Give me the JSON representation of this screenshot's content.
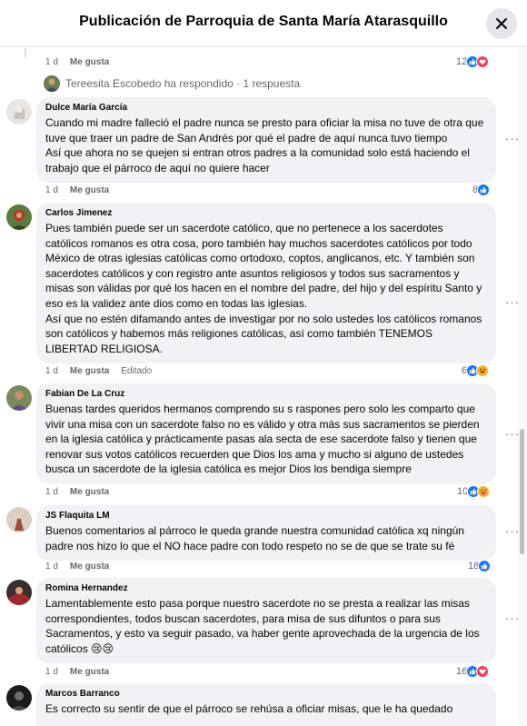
{
  "header": {
    "title": "Publicación de Parroquia de Santa María Atarasquillo"
  },
  "top_reply": {
    "time": "1 d",
    "like_label": "Me gusta",
    "reaction_count": "12",
    "replied_text": "Tereesita Escobedo ha respondido · 1 respuesta"
  },
  "comments": [
    {
      "author": "Dulce María García",
      "text": "Cuando mi madre falleció el padre nunca se presto para oficiar la misa no tuve de otra que tuve que traer un padre de San Andrés por qué el padre de aquí nunca tuvo tiempo\nAsí que ahora no se quejen si entran otros padres a la comunidad solo está haciendo el trabajo que el párroco de aquí no quiere hacer",
      "time": "1 d",
      "like_label": "Me gusta",
      "edited": "",
      "reaction_count": "8"
    },
    {
      "author": "Carlos Jimenez",
      "text": "Pues también puede ser un sacerdote católico, que no pertenece a los sacerdotes católicos romanos es otra cosa, poro también hay muchos sacerdotes católicos por todo México de otras iglesias católicas como ortodoxo, coptos, anglicanos, etc. Y también son sacerdotes católicos y con registro ante asuntos religiosos y todos sus sacramentos y misas son válidas por qué los hacen en el nombre del padre, del hijo y del espíritu Santo y eso es la validez ante dios como en todas las iglesias.\nAsí que no estén difamando antes de investigar por no solo ustedes los católicos romanos son católicos y habemos más religiones católicas, así como también TENEMOS LIBERTAD RELIGIOSA.",
      "time": "1 d",
      "like_label": "Me gusta",
      "edited": "Editado",
      "reaction_count": "6"
    },
    {
      "author": "Fabian De La Cruz",
      "text": "Buenas tardes queridos hermanos comprendo su s raspones pero solo les comparto que vivir una misa con un sacerdote falso no es válido y otra más sus sacramentos se pierden en la iglesia católica y prácticamente pasas ala secta de ese sacerdote falso y tienen que renovar sus votos católicos recuerden que Dios los ama y mucho si alguno de ustedes busca un sacerdote de la iglesia católica es mejor Dios los bendiga siempre",
      "time": "1 d",
      "like_label": "Me gusta",
      "edited": "",
      "reaction_count": "10"
    },
    {
      "author": "JS Flaquita LM",
      "text": "Buenos comentarios al párroco le queda grande nuestra comunidad católica xq ningún padre nos hizo lo que el NO hace padre con todo respeto no se de que se trate su fé",
      "time": "1 d",
      "like_label": "Me gusta",
      "edited": "",
      "reaction_count": "18"
    },
    {
      "author": "Romina Hernandez",
      "text": "Lamentablemente esto pasa porque nuestro sacerdote no se presta a realizar las misas correspondientes, todos buscan sacerdotes, para misa de sus difuntos o para sus Sacramentos, y esto va seguir pasado, va haber gente aprovechada de la urgencia de los católicos 😢😢",
      "time": "1 d",
      "like_label": "Me gusta",
      "edited": "",
      "reaction_count": "16"
    },
    {
      "author": "Marcos Barranco",
      "text": "Es correcto su sentir de que el párroco se rehúsa a oficiar misas, que le ha quedado",
      "time": "",
      "like_label": "",
      "edited": "",
      "reaction_count": ""
    }
  ],
  "colors": {
    "like": "#1877f2",
    "love": "#f33e58",
    "haha": "#f7b125",
    "bubble": "#f0f2f5",
    "meta": "#65676b"
  }
}
